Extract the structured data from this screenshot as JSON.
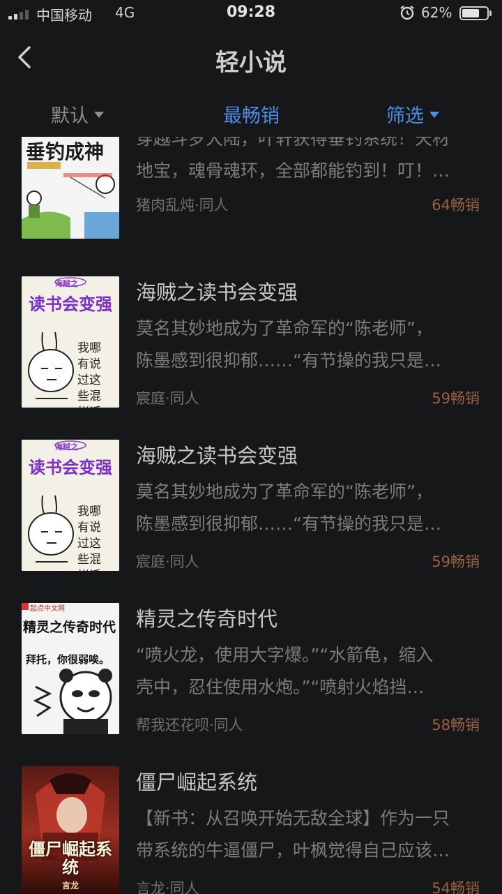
{
  "status_bar": {
    "carrier": "中国移动",
    "network": "4G",
    "time": "09:28",
    "battery_percent": "62%",
    "battery_level": 0.62
  },
  "nav": {
    "title": "轻小说"
  },
  "filters": {
    "default_label": "默认",
    "bestseller_label": "最畅销",
    "filter_label": "筛选"
  },
  "books": [
    {
      "cover_title": "垂钓成神",
      "description_line1": "穿越斗罗大陆，叶轩获得垂钓系统！天材",
      "description_line2": "地宝，魂骨魂环，全部都能钓到！叮！…",
      "author": "猪肉乱炖·同人",
      "sales": "64畅销"
    },
    {
      "title": "海贼之读书会变强",
      "cover_title": "读书会变强",
      "cover_badge": "海贼之",
      "cover_text": "我哪有说过这些混帐话",
      "description_line1": "莫名其妙地成为了革命军的“陈老师”，",
      "description_line2": "陈墨感到很抑郁……“有节操的我只是…",
      "author": "宸庭·同人",
      "sales": "59畅销"
    },
    {
      "title": "海贼之读书会变强",
      "cover_title": "读书会变强",
      "cover_badge": "海贼之",
      "cover_text": "我哪有说过这些混帐话",
      "description_line1": "莫名其妙地成为了革命军的“陈老师”，",
      "description_line2": "陈墨感到很抑郁……“有节操的我只是…",
      "author": "宸庭·同人",
      "sales": "59畅销"
    },
    {
      "title": "精灵之传奇时代",
      "cover_title": "精灵之传奇时代",
      "cover_text": "拜托，你很弱唉。",
      "cover_publisher": "起点中文网",
      "description_line1": "“喷火龙，使用大字爆。”“水箭龟，缩入",
      "description_line2": "壳中，忍住使用水炮。”“喷射火焰挡…",
      "author": "帮我还花呗·同人",
      "sales": "58畅销"
    },
    {
      "title": "僵尸崛起系统",
      "cover_title": "僵尸崛起系统",
      "cover_author": "言龙",
      "description_line1": "【新书：从召唤开始无敌全球】作为一只",
      "description_line2": "带系统的牛逼僵尸，叶枫觉得自己应该…",
      "author": "言龙·同人",
      "sales": "54畅销"
    }
  ],
  "colors": {
    "background": "#161719",
    "accent": "#4d8fe6",
    "sales": "#9a6242"
  }
}
